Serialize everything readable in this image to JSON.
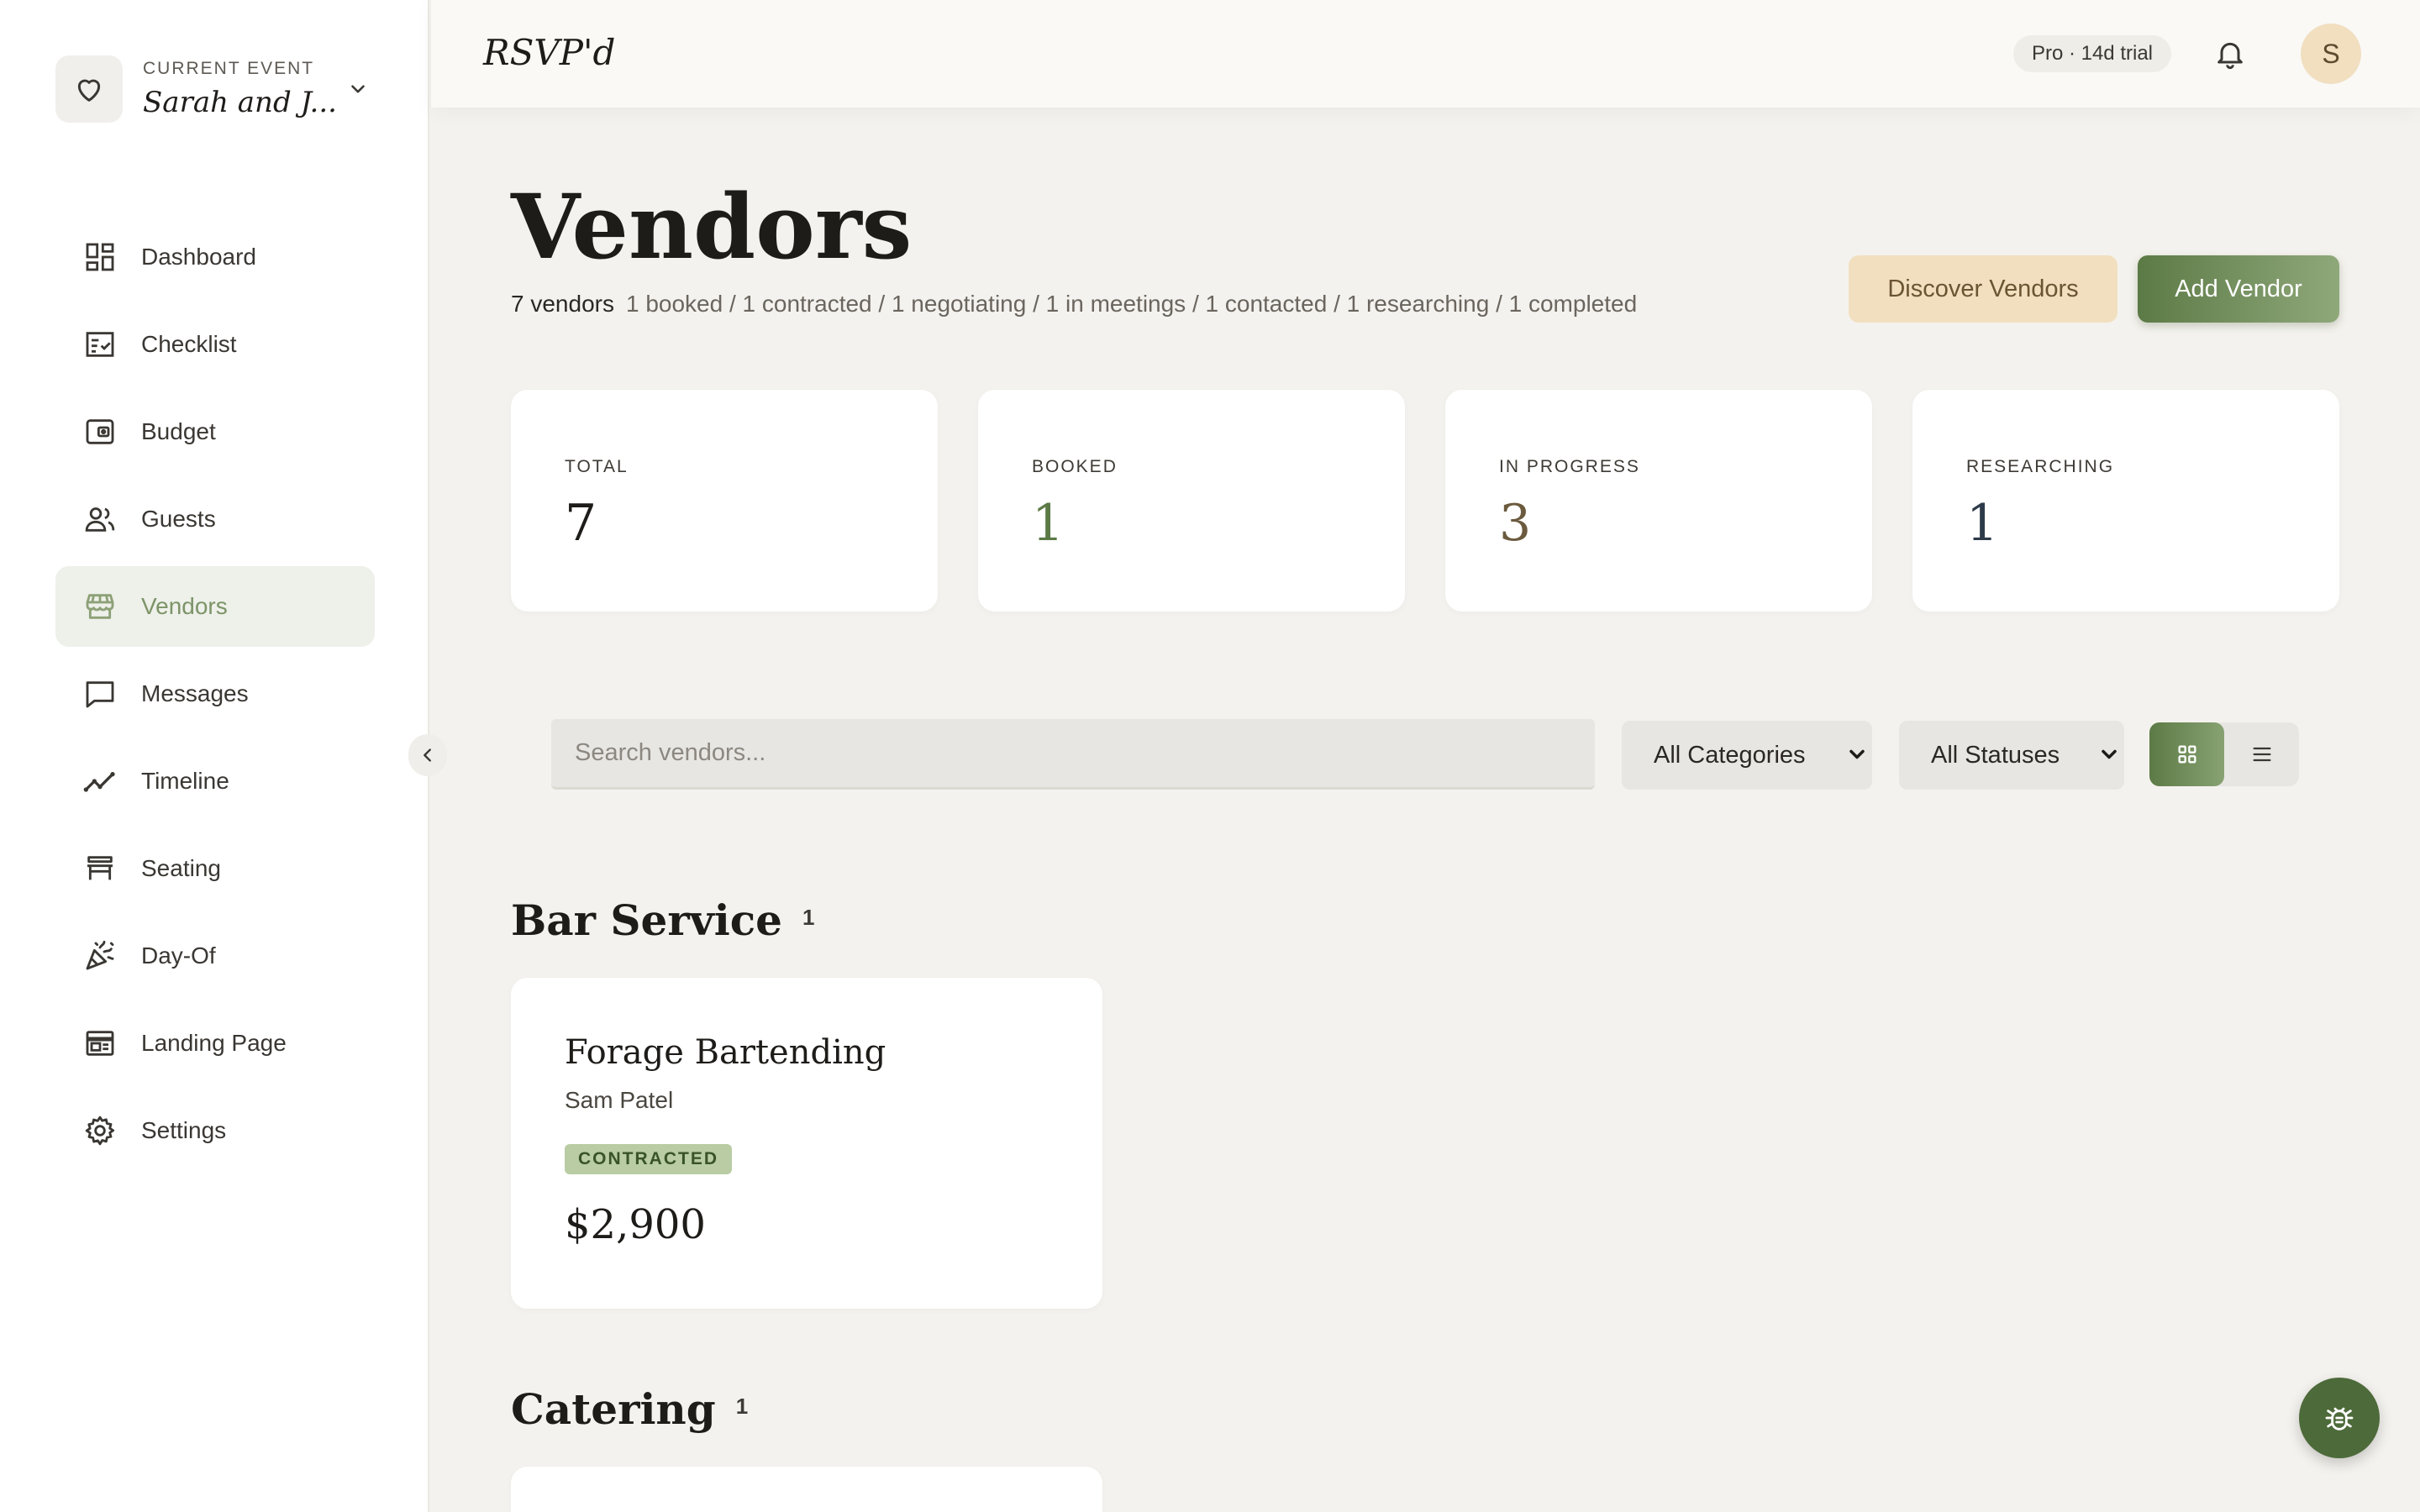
{
  "app": {
    "brand": "RSVP'd",
    "trial_badge": "Pro · 14d trial",
    "avatar_initial": "S"
  },
  "event": {
    "caption": "CURRENT EVENT",
    "name": "Sarah and J..."
  },
  "sidebar": {
    "items": [
      {
        "label": "Dashboard",
        "icon": "dashboard-icon"
      },
      {
        "label": "Checklist",
        "icon": "checklist-icon"
      },
      {
        "label": "Budget",
        "icon": "wallet-icon"
      },
      {
        "label": "Guests",
        "icon": "users-icon"
      },
      {
        "label": "Vendors",
        "icon": "storefront-icon",
        "active": true
      },
      {
        "label": "Messages",
        "icon": "message-icon"
      },
      {
        "label": "Timeline",
        "icon": "trend-line-icon"
      },
      {
        "label": "Seating",
        "icon": "table-icon"
      },
      {
        "label": "Day-Of",
        "icon": "party-popper-icon"
      },
      {
        "label": "Landing Page",
        "icon": "browser-window-icon"
      },
      {
        "label": "Settings",
        "icon": "gear-icon"
      }
    ]
  },
  "page": {
    "title": "Vendors",
    "count": "7 vendors",
    "breakdown": "1 booked / 1 contracted / 1 negotiating / 1 in meetings / 1 contacted / 1 researching / 1 completed",
    "discover_label": "Discover Vendors",
    "add_label": "Add Vendor"
  },
  "stats": [
    {
      "label": "TOTAL",
      "value": "7",
      "color": "#1e1c19"
    },
    {
      "label": "BOOKED",
      "value": "1",
      "color": "#5c7a46"
    },
    {
      "label": "IN PROGRESS",
      "value": "3",
      "color": "#6b5a3e"
    },
    {
      "label": "RESEARCHING",
      "value": "1",
      "color": "#2d3a4a"
    }
  ],
  "filters": {
    "search_placeholder": "Search vendors...",
    "category": "All Categories",
    "status": "All Statuses"
  },
  "groups": [
    {
      "title": "Bar Service",
      "count": "1",
      "vendors": [
        {
          "name": "Forage Bartending",
          "contact": "Sam Patel",
          "status": "CONTRACTED",
          "price": "$2,900"
        }
      ]
    },
    {
      "title": "Catering",
      "count": "1"
    }
  ],
  "colors": {
    "accent": "#5c7a46",
    "sidebar_active_text": "#7c9467",
    "background": "#f4f2ee"
  }
}
